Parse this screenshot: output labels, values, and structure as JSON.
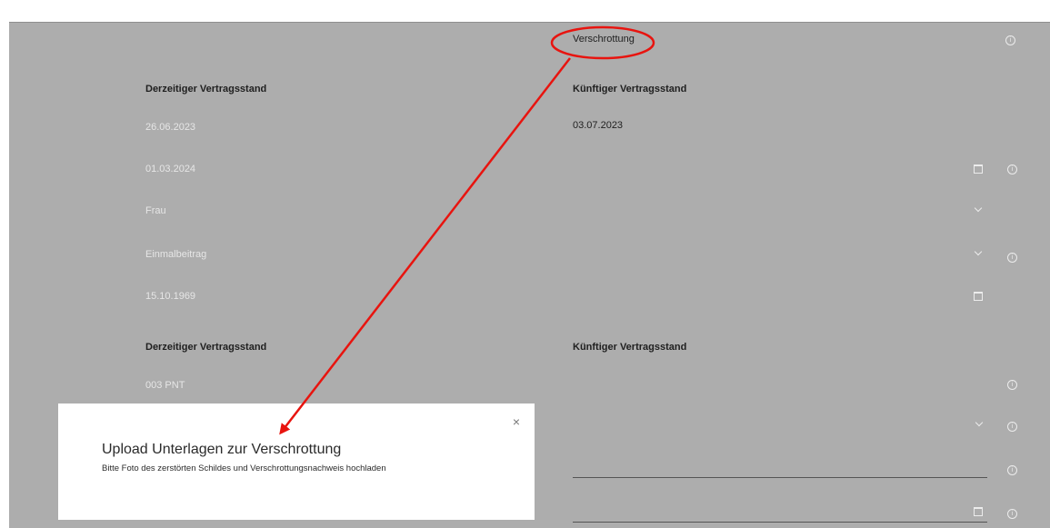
{
  "header": {
    "selected_value": "Verschrottung"
  },
  "section1": {
    "left_heading": "Derzeitiger Vertragsstand",
    "right_heading": "Künftiger Vertragsstand",
    "left_values": [
      "26.06.2023",
      "01.03.2024",
      "Frau",
      "Einmalbeitrag",
      "15.10.1969"
    ],
    "right_values": [
      "03.07.2023"
    ]
  },
  "section2": {
    "left_heading": "Derzeitiger Vertragsstand",
    "right_heading": "Künftiger Vertragsstand",
    "left_values": [
      "003 PNT"
    ]
  },
  "modal": {
    "title": "Upload Unterlagen zur Verschrottung",
    "subtitle": "Bitte Foto des zerstörten Schildes und Verschrottungsnachweis hochladen",
    "close_glyph": "×"
  },
  "annotation": {
    "color": "#e8140f"
  },
  "icons": {
    "info": "info-icon",
    "calendar": "calendar-icon",
    "chevron": "chevron-down-icon"
  }
}
